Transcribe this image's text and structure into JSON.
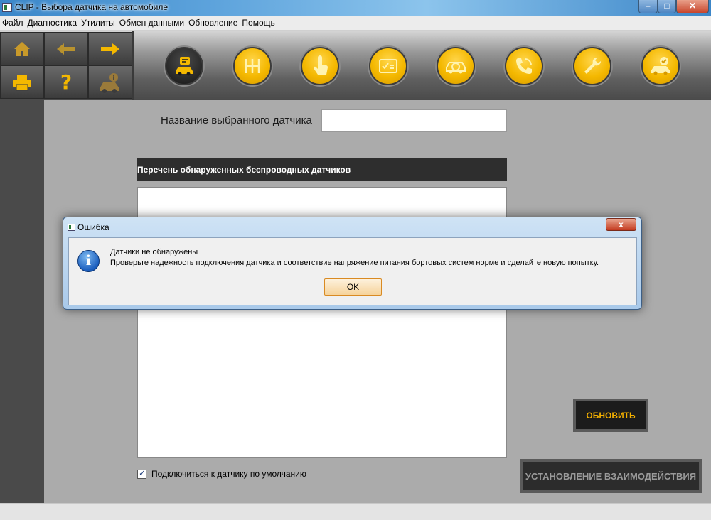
{
  "window": {
    "title": "CLIP - Выбора датчика на автомобиле",
    "minimize_label": "–",
    "maximize_label": "□",
    "close_label": "✕"
  },
  "menu": [
    "Файл",
    "Диагностика",
    "Утилиты",
    "Обмен данными",
    "Обновление",
    "Помощь"
  ],
  "toolbar": {
    "nav_buttons": [
      "home-icon",
      "back-arrow-icon",
      "forward-arrow-icon",
      "printer-icon",
      "help-icon",
      "car-info-icon"
    ],
    "help_glyph": "?",
    "mode_buttons": [
      "car-sensor-icon",
      "gearbox-icon",
      "touch-icon",
      "checklist-icon",
      "car-scan-icon",
      "phone-support-icon",
      "wrench-icon",
      "car-check-icon"
    ],
    "active_mode": "car-sensor-icon",
    "accent_color": "#f4b800"
  },
  "main": {
    "sensor_name_label": "Название выбранного датчика",
    "sensor_name_value": "",
    "list_header": "Перечень обнаруженных беспроводных датчиков",
    "default_checkbox_label": "Подключиться к датчику по умолчанию",
    "default_checkbox_checked": true,
    "refresh_button": "ОБНОВИТЬ",
    "connect_button": "УСТАНОВЛЕНИЕ ВЗАИМОДЕЙСТВИЯ"
  },
  "dialog": {
    "title": "Ошибка",
    "close_label": "x",
    "icon": "info-icon",
    "line1": "Датчики не обнаружены",
    "line2": "Проверьте надежность подключения датчика и соответствие напряжение питания бортовых систем норме и сделайте новую попытку.",
    "ok_button": "OK"
  }
}
